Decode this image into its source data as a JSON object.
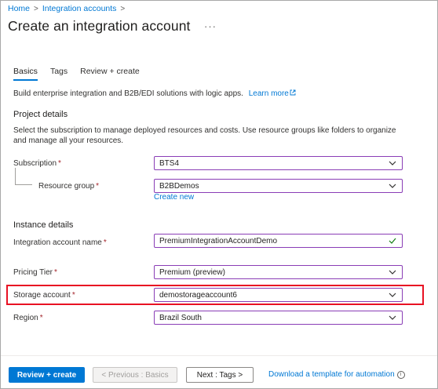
{
  "breadcrumb": {
    "items": [
      "Home",
      "Integration accounts"
    ],
    "separator": ">"
  },
  "page": {
    "title": "Create an integration account",
    "more": "···"
  },
  "tabs": [
    {
      "label": "Basics",
      "active": true
    },
    {
      "label": "Tags",
      "active": false
    },
    {
      "label": "Review + create",
      "active": false
    }
  ],
  "intro": {
    "text": "Build enterprise integration and B2B/EDI solutions with logic apps.",
    "link": "Learn more",
    "link_icon": "external-link-icon"
  },
  "project_details": {
    "heading": "Project details",
    "description": "Select the subscription to manage deployed resources and costs. Use resource groups like folders to organize and manage all your resources.",
    "subscription": {
      "label": "Subscription",
      "required_mark": "*",
      "value": "BTS4"
    },
    "resource_group": {
      "label": "Resource group",
      "required_mark": "*",
      "value": "B2BDemos",
      "create_new": "Create new"
    }
  },
  "instance_details": {
    "heading": "Instance details",
    "name": {
      "label": "Integration account name",
      "required_mark": "*",
      "value": "PremiumIntegrationAccountDemo",
      "valid": true
    },
    "pricing_tier": {
      "label": "Pricing Tier",
      "required_mark": "*",
      "value": "Premium (preview)"
    },
    "storage_account": {
      "label": "Storage account",
      "required_mark": "*",
      "value": "demostorageaccount6"
    },
    "region": {
      "label": "Region",
      "required_mark": "*",
      "value": "Brazil South"
    }
  },
  "footer": {
    "review_create": "Review + create",
    "previous": "< Previous : Basics",
    "next": "Next : Tags >",
    "download": "Download a template for automation",
    "info_icon": "info-icon"
  },
  "colors": {
    "accent": "#0078d4",
    "field_border": "#8a3db6",
    "required": "#a4262c",
    "highlight": "#e81123",
    "valid_check": "#107c10"
  }
}
